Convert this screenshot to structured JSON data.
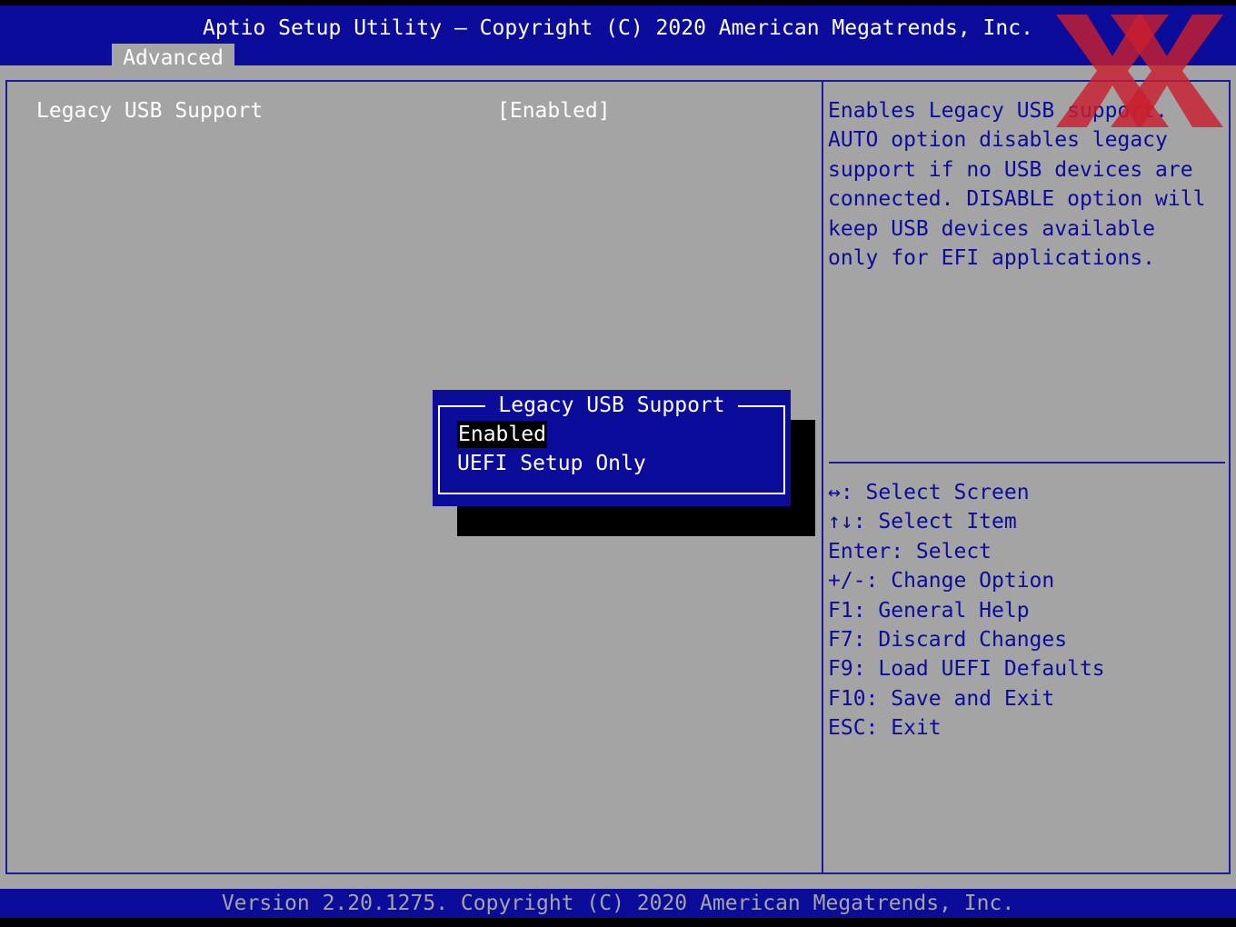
{
  "header": {
    "title": "Aptio Setup Utility – Copyright (C) 2020 American Megatrends, Inc.",
    "active_tab": "Advanced"
  },
  "settings": [
    {
      "label": "Legacy USB Support",
      "value": "[Enabled]"
    }
  ],
  "help": {
    "lines": [
      "Enables Legacy USB support.",
      "AUTO option disables legacy",
      "support if no USB devices are",
      "connected. DISABLE option will",
      "keep USB devices available",
      "only for EFI applications."
    ]
  },
  "keys": [
    "↔: Select Screen",
    "↑↓: Select Item",
    "Enter: Select",
    "+/-: Change Option",
    "F1: General Help",
    "F7: Discard Changes",
    "F9: Load UEFI Defaults",
    "F10: Save and Exit",
    "ESC: Exit"
  ],
  "popup": {
    "title": "Legacy USB Support",
    "options": [
      "Enabled",
      "UEFI Setup Only"
    ],
    "selected_index": 0
  },
  "footer": {
    "version": "Version 2.20.1275. Copyright (C) 2020 American Megatrends, Inc."
  },
  "watermark": {
    "text": "XX",
    "color": "#c81e2d",
    "icon": "xx-logo-icon"
  },
  "colors": {
    "bios_blue": "#0c0c9a",
    "bios_gray": "#a4a4a4"
  }
}
